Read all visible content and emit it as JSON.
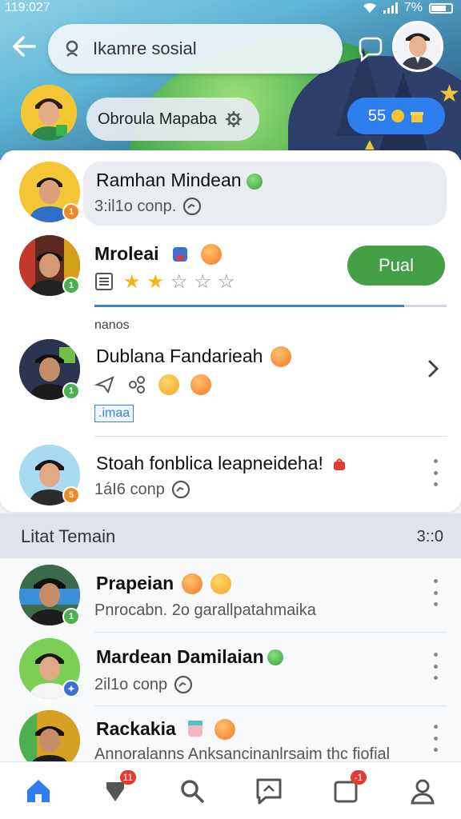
{
  "status_bar": {
    "time": "119:027",
    "battery": "7%"
  },
  "search": {
    "query": "Ikamre sosial"
  },
  "location": {
    "label": "Obroula Mapaba"
  },
  "coins": {
    "value": "55"
  },
  "friends": [
    {
      "name": "Ramhan Mindean",
      "sub": "3:il1o conp.",
      "badge": "1"
    },
    {
      "name": "Mroleai",
      "rating": 2,
      "rating_max": 5,
      "action": "Pual",
      "badge": "1"
    },
    {
      "section_label": "nanos",
      "name": "Dublana Fandarieah",
      "tag": ".imaa",
      "badge": "1"
    },
    {
      "name": "Stoah fonblica leapneideha!",
      "sub": "1áI6 conp",
      "badge": "5"
    }
  ],
  "progress": {
    "value": 0.88
  },
  "section": {
    "title": "Litat Temain",
    "count": "3::0"
  },
  "list2": [
    {
      "name": "Prapeian",
      "sub": "Pnrocabn. 2o garallpatahmaika",
      "badge": "1"
    },
    {
      "name": "Mardean Damilaian",
      "sub": "2il1o conp"
    },
    {
      "name": "Rackakia",
      "sub": "Annoralanns Anksancinanlrsaim thc fiofial"
    }
  ],
  "nav": {
    "messages_badge": "11",
    "notifications_badge": "-1"
  },
  "colors": {
    "primary": "#2f7ef0",
    "action_green": "#43a047",
    "star": "#f2b619"
  }
}
